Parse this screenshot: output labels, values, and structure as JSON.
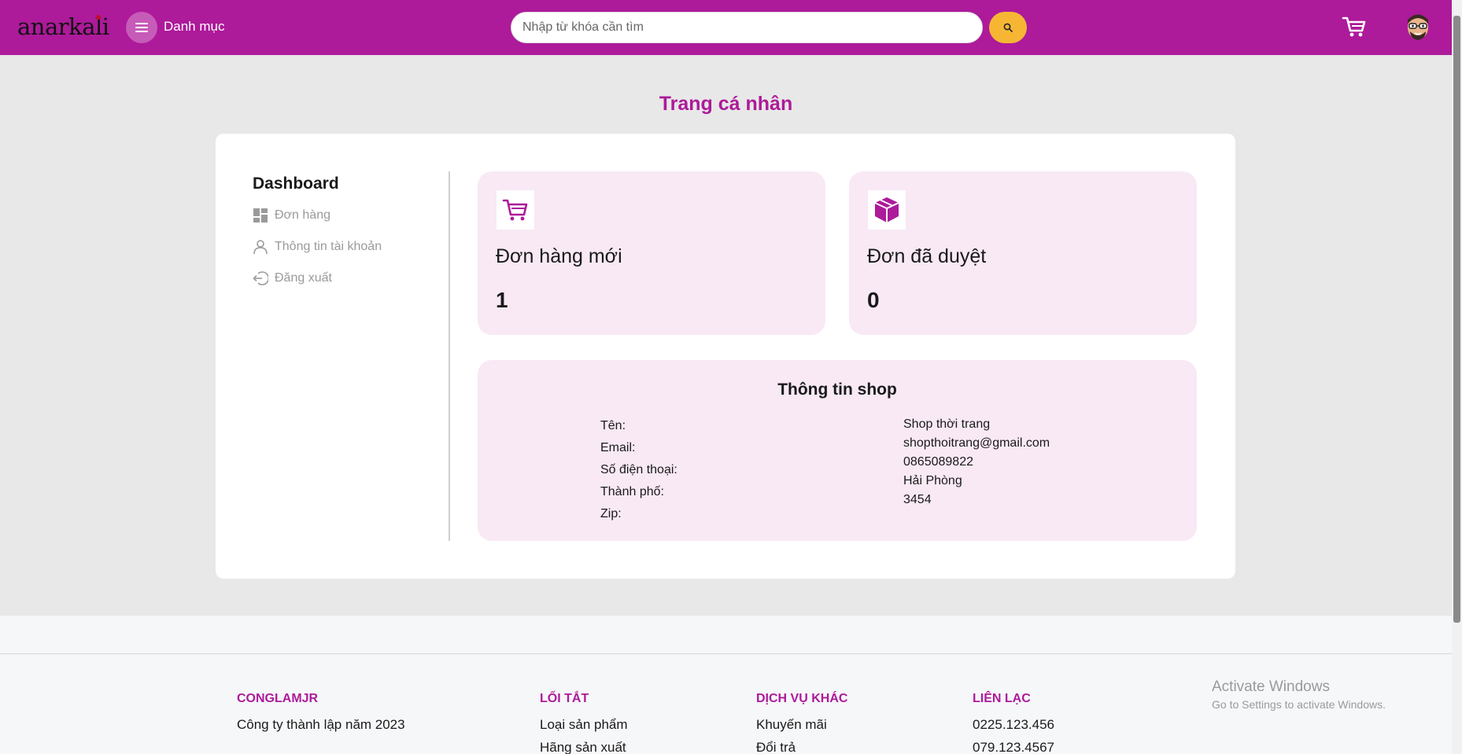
{
  "header": {
    "logo": "anarkali",
    "menu_label": "Danh mục",
    "search_placeholder": "Nhập từ khóa cần tìm",
    "brand_color": "#ad1a9a",
    "accent_color": "#f6b634"
  },
  "page_title": "Trang cá nhân",
  "sidebar": {
    "title": "Dashboard",
    "items": [
      {
        "label": "Đơn hàng",
        "icon": "dashboard-grid-icon"
      },
      {
        "label": "Thông tin tài khoản",
        "icon": "user-icon"
      },
      {
        "label": "Đăng xuất",
        "icon": "logout-icon"
      }
    ]
  },
  "stats": [
    {
      "label": "Đơn hàng mới",
      "value": "1",
      "icon": "cart-icon"
    },
    {
      "label": "Đơn đã duyệt",
      "value": "0",
      "icon": "box-icon"
    }
  ],
  "shop_info": {
    "title": "Thông tin shop",
    "labels": [
      "Tên:",
      "Email:",
      "Số điện thoại:",
      "Thành phố:",
      "Zip:"
    ],
    "values": [
      "Shop thời trang",
      "shopthoitrang@gmail.com",
      "0865089822",
      "Hải Phòng",
      "3454"
    ]
  },
  "footer": {
    "columns": [
      {
        "title": "CONGLAMJR",
        "items": [
          "Công ty thành lập năm 2023"
        ]
      },
      {
        "title": "LỐI TẮT",
        "items": [
          "Loại sản phẩm",
          "Hãng sản xuất"
        ]
      },
      {
        "title": "DỊCH VỤ KHÁC",
        "items": [
          "Khuyến mãi",
          "Đổi trả"
        ]
      },
      {
        "title": "LIÊN LẠC",
        "items": [
          "0225.123.456",
          "079.123.4567"
        ]
      }
    ]
  },
  "watermark": {
    "line1": "Activate Windows",
    "line2": "Go to Settings to activate Windows."
  }
}
